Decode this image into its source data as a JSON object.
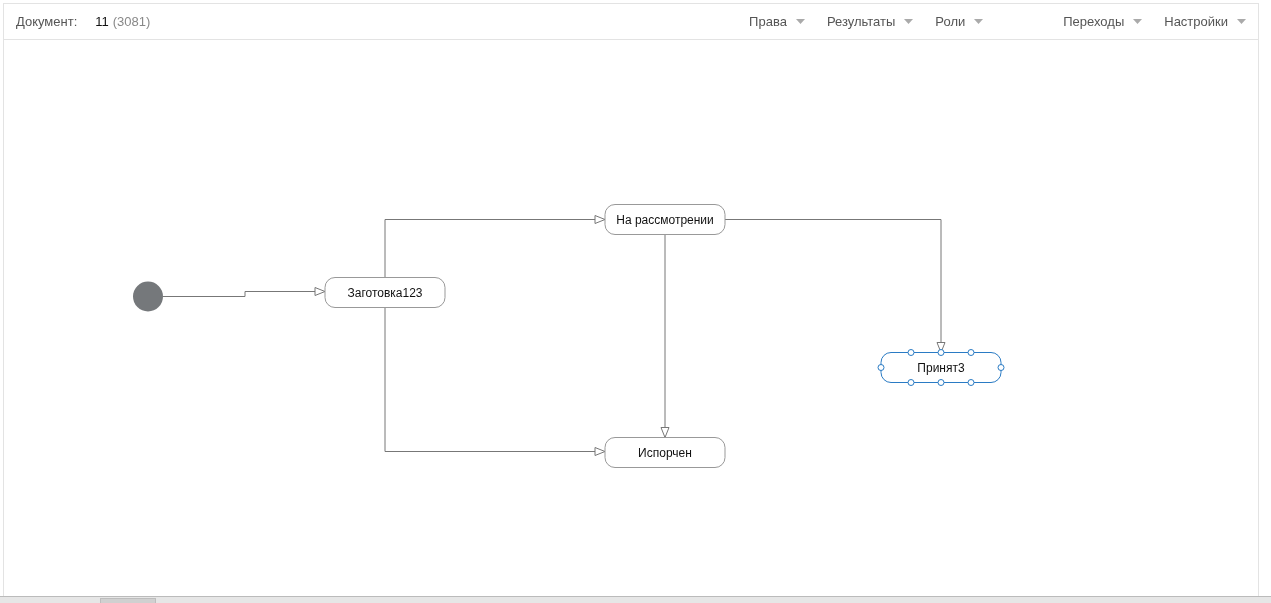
{
  "header": {
    "document_label": "Документ:",
    "document_number": "11",
    "document_id": "(3081)"
  },
  "menu": [
    {
      "label": "Права"
    },
    {
      "label": "Результаты"
    },
    {
      "label": "Роли"
    },
    {
      "label": "Переходы"
    },
    {
      "label": "Настройки"
    }
  ],
  "diagram": {
    "nodes": [
      {
        "label": "Заготовка123",
        "selected": false
      },
      {
        "label": "На рассмотрении",
        "selected": false
      },
      {
        "label": "Испорчен",
        "selected": false
      },
      {
        "label": "Принят3",
        "selected": true
      }
    ]
  }
}
